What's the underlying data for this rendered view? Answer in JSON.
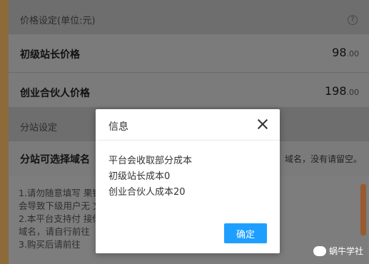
{
  "price_section": {
    "title": "价格设定(单位:元)",
    "help_icon_text": "?",
    "rows": [
      {
        "label": "初级站长价格",
        "price_int": "98",
        "price_cents": ".00"
      },
      {
        "label": "创业合伙人价格",
        "price_int": "198",
        "price_cents": ".00"
      }
    ]
  },
  "substation_section": {
    "title": "分站设定",
    "domain_label": "分站可选择域名",
    "domain_hint": "域名，没有请留空。"
  },
  "instructions": [
    "1.请勿随意填写                                         果错误填写，将",
    "会导致下级用户无                                       文逗号\",\"隔开。",
    "2.本平台支持付                                         接你自己的独立",
    "域名，请自行前往",
    "3.购买后请前往"
  ],
  "watermark": "蜗牛学社",
  "modal": {
    "title": "信息",
    "lines": [
      "平台会收取部分成本",
      "初级站长成本0",
      "创业合伙人成本20"
    ],
    "ok_label": "确定"
  }
}
